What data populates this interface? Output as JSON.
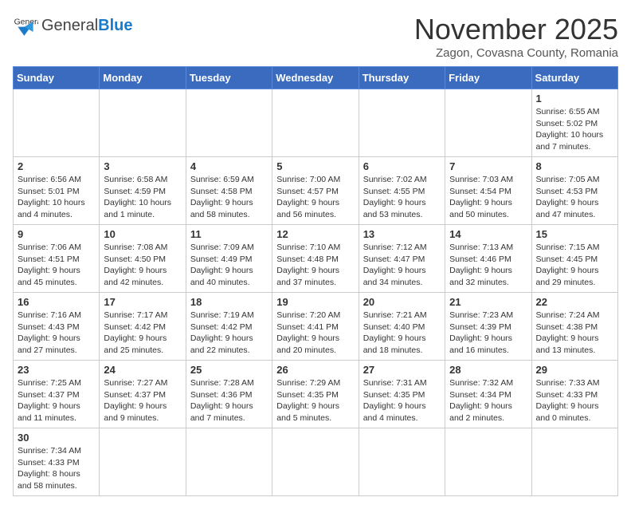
{
  "header": {
    "logo_general": "General",
    "logo_blue": "Blue",
    "month_title": "November 2025",
    "location": "Zagon, Covasna County, Romania"
  },
  "days_of_week": [
    "Sunday",
    "Monday",
    "Tuesday",
    "Wednesday",
    "Thursday",
    "Friday",
    "Saturday"
  ],
  "weeks": [
    [
      {
        "day": "",
        "info": ""
      },
      {
        "day": "",
        "info": ""
      },
      {
        "day": "",
        "info": ""
      },
      {
        "day": "",
        "info": ""
      },
      {
        "day": "",
        "info": ""
      },
      {
        "day": "",
        "info": ""
      },
      {
        "day": "1",
        "info": "Sunrise: 6:55 AM\nSunset: 5:02 PM\nDaylight: 10 hours and 7 minutes."
      }
    ],
    [
      {
        "day": "2",
        "info": "Sunrise: 6:56 AM\nSunset: 5:01 PM\nDaylight: 10 hours and 4 minutes."
      },
      {
        "day": "3",
        "info": "Sunrise: 6:58 AM\nSunset: 4:59 PM\nDaylight: 10 hours and 1 minute."
      },
      {
        "day": "4",
        "info": "Sunrise: 6:59 AM\nSunset: 4:58 PM\nDaylight: 9 hours and 58 minutes."
      },
      {
        "day": "5",
        "info": "Sunrise: 7:00 AM\nSunset: 4:57 PM\nDaylight: 9 hours and 56 minutes."
      },
      {
        "day": "6",
        "info": "Sunrise: 7:02 AM\nSunset: 4:55 PM\nDaylight: 9 hours and 53 minutes."
      },
      {
        "day": "7",
        "info": "Sunrise: 7:03 AM\nSunset: 4:54 PM\nDaylight: 9 hours and 50 minutes."
      },
      {
        "day": "8",
        "info": "Sunrise: 7:05 AM\nSunset: 4:53 PM\nDaylight: 9 hours and 47 minutes."
      }
    ],
    [
      {
        "day": "9",
        "info": "Sunrise: 7:06 AM\nSunset: 4:51 PM\nDaylight: 9 hours and 45 minutes."
      },
      {
        "day": "10",
        "info": "Sunrise: 7:08 AM\nSunset: 4:50 PM\nDaylight: 9 hours and 42 minutes."
      },
      {
        "day": "11",
        "info": "Sunrise: 7:09 AM\nSunset: 4:49 PM\nDaylight: 9 hours and 40 minutes."
      },
      {
        "day": "12",
        "info": "Sunrise: 7:10 AM\nSunset: 4:48 PM\nDaylight: 9 hours and 37 minutes."
      },
      {
        "day": "13",
        "info": "Sunrise: 7:12 AM\nSunset: 4:47 PM\nDaylight: 9 hours and 34 minutes."
      },
      {
        "day": "14",
        "info": "Sunrise: 7:13 AM\nSunset: 4:46 PM\nDaylight: 9 hours and 32 minutes."
      },
      {
        "day": "15",
        "info": "Sunrise: 7:15 AM\nSunset: 4:45 PM\nDaylight: 9 hours and 29 minutes."
      }
    ],
    [
      {
        "day": "16",
        "info": "Sunrise: 7:16 AM\nSunset: 4:43 PM\nDaylight: 9 hours and 27 minutes."
      },
      {
        "day": "17",
        "info": "Sunrise: 7:17 AM\nSunset: 4:42 PM\nDaylight: 9 hours and 25 minutes."
      },
      {
        "day": "18",
        "info": "Sunrise: 7:19 AM\nSunset: 4:42 PM\nDaylight: 9 hours and 22 minutes."
      },
      {
        "day": "19",
        "info": "Sunrise: 7:20 AM\nSunset: 4:41 PM\nDaylight: 9 hours and 20 minutes."
      },
      {
        "day": "20",
        "info": "Sunrise: 7:21 AM\nSunset: 4:40 PM\nDaylight: 9 hours and 18 minutes."
      },
      {
        "day": "21",
        "info": "Sunrise: 7:23 AM\nSunset: 4:39 PM\nDaylight: 9 hours and 16 minutes."
      },
      {
        "day": "22",
        "info": "Sunrise: 7:24 AM\nSunset: 4:38 PM\nDaylight: 9 hours and 13 minutes."
      }
    ],
    [
      {
        "day": "23",
        "info": "Sunrise: 7:25 AM\nSunset: 4:37 PM\nDaylight: 9 hours and 11 minutes."
      },
      {
        "day": "24",
        "info": "Sunrise: 7:27 AM\nSunset: 4:37 PM\nDaylight: 9 hours and 9 minutes."
      },
      {
        "day": "25",
        "info": "Sunrise: 7:28 AM\nSunset: 4:36 PM\nDaylight: 9 hours and 7 minutes."
      },
      {
        "day": "26",
        "info": "Sunrise: 7:29 AM\nSunset: 4:35 PM\nDaylight: 9 hours and 5 minutes."
      },
      {
        "day": "27",
        "info": "Sunrise: 7:31 AM\nSunset: 4:35 PM\nDaylight: 9 hours and 4 minutes."
      },
      {
        "day": "28",
        "info": "Sunrise: 7:32 AM\nSunset: 4:34 PM\nDaylight: 9 hours and 2 minutes."
      },
      {
        "day": "29",
        "info": "Sunrise: 7:33 AM\nSunset: 4:33 PM\nDaylight: 9 hours and 0 minutes."
      }
    ],
    [
      {
        "day": "30",
        "info": "Sunrise: 7:34 AM\nSunset: 4:33 PM\nDaylight: 8 hours and 58 minutes."
      },
      {
        "day": "",
        "info": ""
      },
      {
        "day": "",
        "info": ""
      },
      {
        "day": "",
        "info": ""
      },
      {
        "day": "",
        "info": ""
      },
      {
        "day": "",
        "info": ""
      },
      {
        "day": "",
        "info": ""
      }
    ]
  ]
}
